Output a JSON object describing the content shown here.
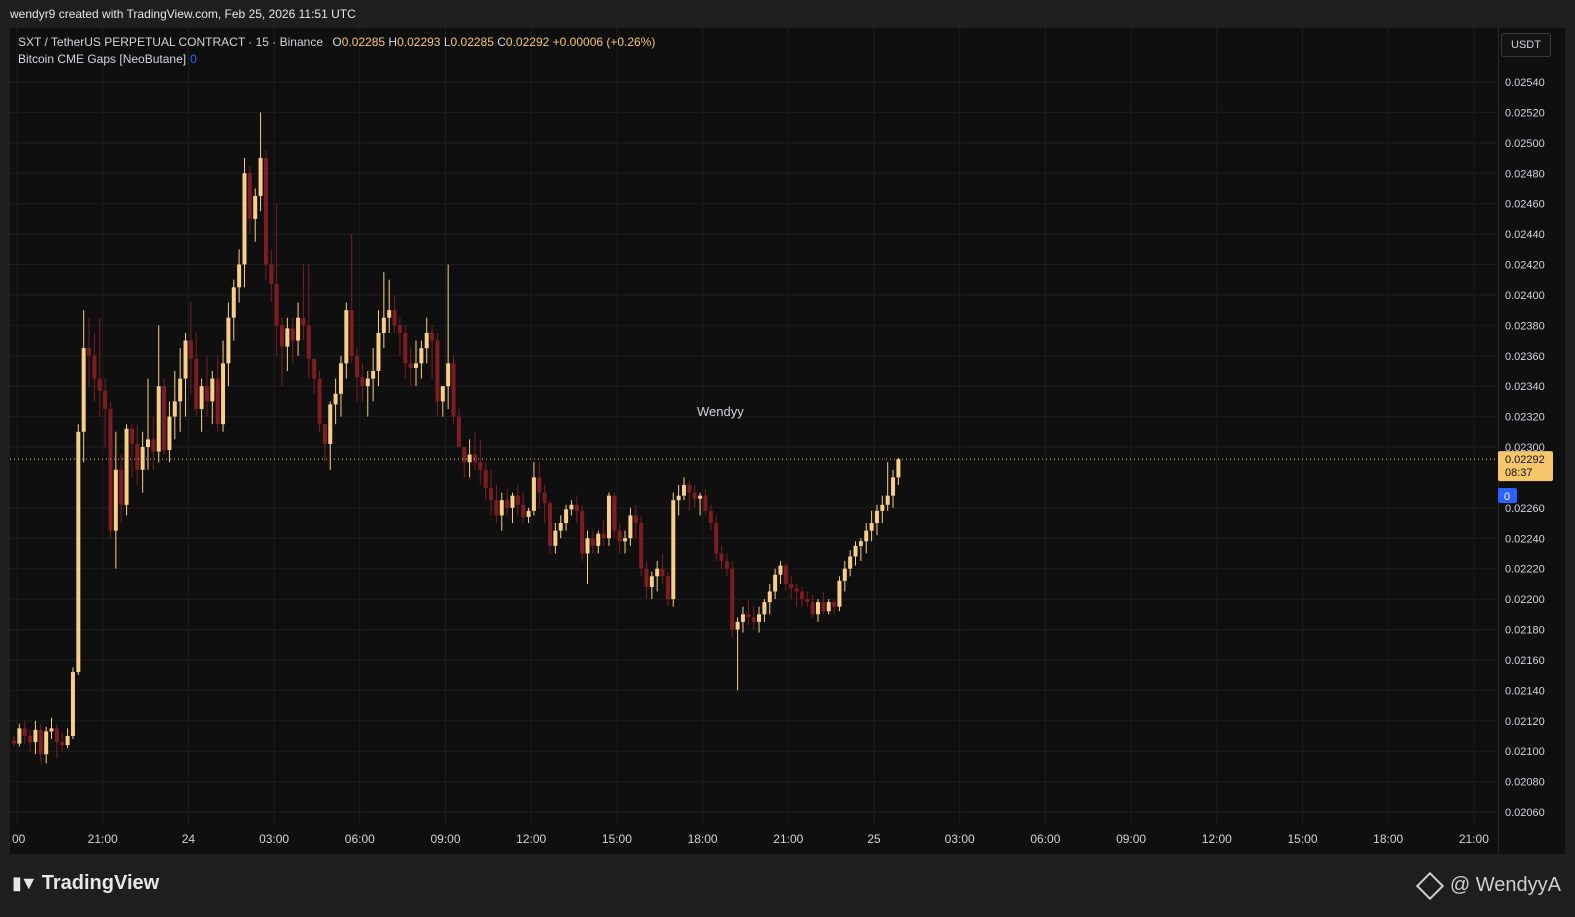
{
  "header": {
    "attribution": "wendyr9 created with TradingView.com, Feb 25, 2026 11:51 UTC"
  },
  "legend": {
    "symbol": "SXT / TetherUS PERPETUAL CONTRACT · 15 · Binance",
    "o_label": "O",
    "o_value": "0.02285",
    "h_label": "H",
    "h_value": "0.02293",
    "l_label": "L",
    "l_value": "0.02285",
    "c_label": "C",
    "c_value": "0.02292",
    "change": "+0.00006 (+0.26%)",
    "indicator": "Bitcoin CME Gaps [NeoButane]",
    "indicator_value": "0"
  },
  "currency_button": "USDT",
  "annotation_text": "Wendyy",
  "footer": {
    "brand": "TradingView",
    "watermark": "@ WendyyA"
  },
  "colors": {
    "bg": "#0f0f0f",
    "up": "#f7cf86",
    "down": "#7d1d22",
    "grid": "#1d1d1d",
    "last_price": "#f7c66b",
    "gap_badge": "#2962ff"
  },
  "chart_data": {
    "type": "candlestick",
    "title": "SXT / TetherUS PERPETUAL CONTRACT · 15 · Binance",
    "y_range": [
      0.0205,
      0.0256
    ],
    "y_ticks": [
      "0.02540",
      "0.02520",
      "0.02500",
      "0.02480",
      "0.02460",
      "0.02440",
      "0.02420",
      "0.02400",
      "0.02380",
      "0.02360",
      "0.02340",
      "0.02320",
      "0.02300",
      "0.02260",
      "0.02240",
      "0.02220",
      "0.02200",
      "0.02180",
      "0.02160",
      "0.02140",
      "0.02120",
      "0.02100",
      "0.02080",
      "0.02060"
    ],
    "x_ticks": [
      "00",
      "21:00",
      "24",
      "03:00",
      "06:00",
      "09:00",
      "12:00",
      "15:00",
      "18:00",
      "21:00",
      "25",
      "03:00",
      "06:00",
      "09:00",
      "12:00",
      "15:00",
      "18:00",
      "21:00"
    ],
    "last_price": "0.02292",
    "countdown": "08:37",
    "gap_value": "0",
    "candles": [
      [
        0.02107,
        0.0211,
        0.02103,
        0.02105
      ],
      [
        0.02105,
        0.02118,
        0.02103,
        0.02115
      ],
      [
        0.02115,
        0.0212,
        0.02105,
        0.0211
      ],
      [
        0.0211,
        0.02114,
        0.021,
        0.02106
      ],
      [
        0.02106,
        0.0212,
        0.02098,
        0.02114
      ],
      [
        0.02114,
        0.02118,
        0.02092,
        0.02098
      ],
      [
        0.02098,
        0.02116,
        0.02092,
        0.02113
      ],
      [
        0.02113,
        0.02122,
        0.02108,
        0.02115
      ],
      [
        0.02115,
        0.02118,
        0.02095,
        0.02106
      ],
      [
        0.02106,
        0.02112,
        0.021,
        0.02104
      ],
      [
        0.02104,
        0.02115,
        0.02102,
        0.0211
      ],
      [
        0.0211,
        0.02155,
        0.02108,
        0.02152
      ],
      [
        0.02152,
        0.02315,
        0.0215,
        0.0231
      ],
      [
        0.0231,
        0.0239,
        0.0229,
        0.02365
      ],
      [
        0.02365,
        0.02385,
        0.0234,
        0.0236
      ],
      [
        0.0236,
        0.02375,
        0.0233,
        0.02345
      ],
      [
        0.02345,
        0.02385,
        0.0232,
        0.02337
      ],
      [
        0.02337,
        0.02345,
        0.023,
        0.02325
      ],
      [
        0.02325,
        0.0233,
        0.0224,
        0.02245
      ],
      [
        0.02245,
        0.0231,
        0.0222,
        0.02285
      ],
      [
        0.02285,
        0.02295,
        0.0225,
        0.02262
      ],
      [
        0.02262,
        0.02315,
        0.02255,
        0.02312
      ],
      [
        0.02312,
        0.02315,
        0.0228,
        0.02302
      ],
      [
        0.02302,
        0.02315,
        0.02275,
        0.02285
      ],
      [
        0.02285,
        0.0231,
        0.0227,
        0.023
      ],
      [
        0.023,
        0.02345,
        0.02285,
        0.02305
      ],
      [
        0.02305,
        0.0232,
        0.02285,
        0.02297
      ],
      [
        0.02297,
        0.0238,
        0.0229,
        0.0234
      ],
      [
        0.0234,
        0.02345,
        0.02295,
        0.02298
      ],
      [
        0.02298,
        0.0233,
        0.0229,
        0.0232
      ],
      [
        0.0232,
        0.0235,
        0.02305,
        0.0233
      ],
      [
        0.0233,
        0.02365,
        0.0231,
        0.02345
      ],
      [
        0.02345,
        0.02375,
        0.0232,
        0.0237
      ],
      [
        0.0237,
        0.02395,
        0.02335,
        0.02358
      ],
      [
        0.02358,
        0.02375,
        0.0232,
        0.02325
      ],
      [
        0.02325,
        0.02345,
        0.0231,
        0.0234
      ],
      [
        0.0234,
        0.0236,
        0.0232,
        0.0233
      ],
      [
        0.0233,
        0.0235,
        0.02315,
        0.02345
      ],
      [
        0.02345,
        0.0236,
        0.0231,
        0.02315
      ],
      [
        0.02315,
        0.0237,
        0.0231,
        0.02355
      ],
      [
        0.02355,
        0.02395,
        0.0234,
        0.02385
      ],
      [
        0.02385,
        0.0241,
        0.0237,
        0.02405
      ],
      [
        0.02405,
        0.0243,
        0.02395,
        0.0242
      ],
      [
        0.0242,
        0.0249,
        0.02405,
        0.0248
      ],
      [
        0.0248,
        0.02485,
        0.0244,
        0.0245
      ],
      [
        0.0245,
        0.0247,
        0.02435,
        0.02465
      ],
      [
        0.02465,
        0.0252,
        0.02455,
        0.0249
      ],
      [
        0.0249,
        0.02495,
        0.0241,
        0.0242
      ],
      [
        0.0242,
        0.0243,
        0.02395,
        0.02407
      ],
      [
        0.02407,
        0.0246,
        0.0236,
        0.0238
      ],
      [
        0.0238,
        0.02385,
        0.0234,
        0.02366
      ],
      [
        0.02366,
        0.02385,
        0.0235,
        0.02378
      ],
      [
        0.02378,
        0.02385,
        0.02355,
        0.0237
      ],
      [
        0.0237,
        0.02395,
        0.0236,
        0.02385
      ],
      [
        0.02385,
        0.0242,
        0.0237,
        0.0238
      ],
      [
        0.0238,
        0.0242,
        0.02345,
        0.02358
      ],
      [
        0.02358,
        0.02355,
        0.02335,
        0.02345
      ],
      [
        0.02345,
        0.0235,
        0.0231,
        0.02315
      ],
      [
        0.02315,
        0.0231,
        0.0229,
        0.02302
      ],
      [
        0.02302,
        0.0233,
        0.02285,
        0.02328
      ],
      [
        0.02328,
        0.02345,
        0.02315,
        0.02335
      ],
      [
        0.02335,
        0.0236,
        0.0232,
        0.02355
      ],
      [
        0.02355,
        0.02395,
        0.02345,
        0.0239
      ],
      [
        0.0239,
        0.0244,
        0.02355,
        0.0236
      ],
      [
        0.0236,
        0.02365,
        0.0233,
        0.02346
      ],
      [
        0.02346,
        0.02355,
        0.0233,
        0.0234
      ],
      [
        0.0234,
        0.0235,
        0.0232,
        0.02345
      ],
      [
        0.02345,
        0.02365,
        0.0233,
        0.0235
      ],
      [
        0.0235,
        0.0239,
        0.0234,
        0.02375
      ],
      [
        0.02375,
        0.02415,
        0.02365,
        0.02385
      ],
      [
        0.02385,
        0.0241,
        0.02375,
        0.0239
      ],
      [
        0.0239,
        0.024,
        0.02375,
        0.0238
      ],
      [
        0.0238,
        0.02385,
        0.0236,
        0.02375
      ],
      [
        0.02375,
        0.0238,
        0.02345,
        0.02355
      ],
      [
        0.02355,
        0.02365,
        0.0234,
        0.02352
      ],
      [
        0.02352,
        0.0237,
        0.0234,
        0.02355
      ],
      [
        0.02355,
        0.0237,
        0.02345,
        0.02365
      ],
      [
        0.02365,
        0.02385,
        0.02355,
        0.02375
      ],
      [
        0.02375,
        0.0238,
        0.02345,
        0.0237
      ],
      [
        0.0237,
        0.02375,
        0.0232,
        0.0233
      ],
      [
        0.0233,
        0.0234,
        0.0232,
        0.0234
      ],
      [
        0.0234,
        0.0242,
        0.02325,
        0.02355
      ],
      [
        0.02355,
        0.0236,
        0.02315,
        0.0232
      ],
      [
        0.0232,
        0.02325,
        0.023,
        0.023
      ],
      [
        0.023,
        0.023,
        0.0228,
        0.0229
      ],
      [
        0.0229,
        0.02305,
        0.0228,
        0.02295
      ],
      [
        0.02295,
        0.0231,
        0.02285,
        0.0229
      ],
      [
        0.0229,
        0.02305,
        0.02275,
        0.02285
      ],
      [
        0.02285,
        0.0229,
        0.02265,
        0.02273
      ],
      [
        0.02273,
        0.02285,
        0.02255,
        0.02265
      ],
      [
        0.02265,
        0.02275,
        0.0225,
        0.02255
      ],
      [
        0.02255,
        0.0227,
        0.02245,
        0.02265
      ],
      [
        0.02265,
        0.02272,
        0.02255,
        0.0226
      ],
      [
        0.0226,
        0.0227,
        0.0225,
        0.02268
      ],
      [
        0.02268,
        0.02275,
        0.02255,
        0.02262
      ],
      [
        0.02262,
        0.0227,
        0.0225,
        0.02254
      ],
      [
        0.02254,
        0.0226,
        0.0225,
        0.02258
      ],
      [
        0.02258,
        0.0229,
        0.02255,
        0.0228
      ],
      [
        0.0228,
        0.0229,
        0.0226,
        0.0227
      ],
      [
        0.0227,
        0.02275,
        0.0225,
        0.02263
      ],
      [
        0.02263,
        0.02265,
        0.0223,
        0.02235
      ],
      [
        0.02235,
        0.0225,
        0.0223,
        0.02245
      ],
      [
        0.02245,
        0.02255,
        0.0224,
        0.0225
      ],
      [
        0.0225,
        0.02262,
        0.02245,
        0.02259
      ],
      [
        0.02259,
        0.02265,
        0.02255,
        0.02262
      ],
      [
        0.02262,
        0.02268,
        0.0225,
        0.02258
      ],
      [
        0.02258,
        0.02262,
        0.02225,
        0.0223
      ],
      [
        0.0223,
        0.02245,
        0.0221,
        0.0224
      ],
      [
        0.0224,
        0.02245,
        0.0223,
        0.02235
      ],
      [
        0.02235,
        0.02245,
        0.0223,
        0.02243
      ],
      [
        0.02243,
        0.02252,
        0.02235,
        0.0224
      ],
      [
        0.0224,
        0.0227,
        0.02235,
        0.02268
      ],
      [
        0.02268,
        0.0227,
        0.0224,
        0.02245
      ],
      [
        0.02245,
        0.0225,
        0.0223,
        0.02238
      ],
      [
        0.02238,
        0.02245,
        0.0223,
        0.0224
      ],
      [
        0.0224,
        0.0226,
        0.02235,
        0.02255
      ],
      [
        0.02255,
        0.02262,
        0.0224,
        0.0225
      ],
      [
        0.0225,
        0.02255,
        0.02215,
        0.0222
      ],
      [
        0.0222,
        0.02225,
        0.022,
        0.02208
      ],
      [
        0.02208,
        0.02218,
        0.022,
        0.02215
      ],
      [
        0.02215,
        0.02225,
        0.02205,
        0.0222
      ],
      [
        0.0222,
        0.0223,
        0.0221,
        0.02215
      ],
      [
        0.02215,
        0.02218,
        0.02195,
        0.022
      ],
      [
        0.022,
        0.0227,
        0.02195,
        0.02265
      ],
      [
        0.02265,
        0.02275,
        0.02255,
        0.02268
      ],
      [
        0.02268,
        0.0228,
        0.02265,
        0.02275
      ],
      [
        0.02275,
        0.02278,
        0.02258,
        0.0227
      ],
      [
        0.0227,
        0.02275,
        0.0226,
        0.02266
      ],
      [
        0.02266,
        0.0227,
        0.02255,
        0.02268
      ],
      [
        0.02268,
        0.02272,
        0.02255,
        0.02258
      ],
      [
        0.02258,
        0.02262,
        0.02245,
        0.0225
      ],
      [
        0.0225,
        0.02255,
        0.02225,
        0.0223
      ],
      [
        0.0223,
        0.02235,
        0.0222,
        0.02225
      ],
      [
        0.02225,
        0.0223,
        0.02215,
        0.0222
      ],
      [
        0.0222,
        0.02225,
        0.02175,
        0.0218
      ],
      [
        0.0218,
        0.02188,
        0.0214,
        0.02185
      ],
      [
        0.02185,
        0.02195,
        0.02178,
        0.0219
      ],
      [
        0.0219,
        0.022,
        0.02183,
        0.02188
      ],
      [
        0.02188,
        0.02195,
        0.0218,
        0.02185
      ],
      [
        0.02185,
        0.02195,
        0.02178,
        0.0219
      ],
      [
        0.0219,
        0.022,
        0.02185,
        0.02198
      ],
      [
        0.02198,
        0.0221,
        0.0219,
        0.02205
      ],
      [
        0.02205,
        0.0222,
        0.022,
        0.02216
      ],
      [
        0.02216,
        0.02225,
        0.0221,
        0.02222
      ],
      [
        0.02222,
        0.02224,
        0.02205,
        0.0221
      ],
      [
        0.0221,
        0.02215,
        0.022,
        0.02207
      ],
      [
        0.02207,
        0.0221,
        0.02195,
        0.02205
      ],
      [
        0.02205,
        0.02208,
        0.02195,
        0.022
      ],
      [
        0.022,
        0.02205,
        0.02195,
        0.02198
      ],
      [
        0.02198,
        0.02203,
        0.02188,
        0.0219
      ],
      [
        0.0219,
        0.022,
        0.02185,
        0.02198
      ],
      [
        0.02198,
        0.02205,
        0.0219,
        0.02192
      ],
      [
        0.02192,
        0.022,
        0.0219,
        0.02198
      ],
      [
        0.02198,
        0.022,
        0.0219,
        0.02195
      ],
      [
        0.02195,
        0.02215,
        0.02192,
        0.02212
      ],
      [
        0.02212,
        0.02225,
        0.02205,
        0.0222
      ],
      [
        0.0222,
        0.02232,
        0.02215,
        0.02228
      ],
      [
        0.02228,
        0.02238,
        0.02222,
        0.02235
      ],
      [
        0.02235,
        0.0224,
        0.02225,
        0.02238
      ],
      [
        0.02238,
        0.0225,
        0.0223,
        0.02245
      ],
      [
        0.02245,
        0.02258,
        0.02238,
        0.0225
      ],
      [
        0.0225,
        0.02262,
        0.02242,
        0.02258
      ],
      [
        0.02258,
        0.02268,
        0.0225,
        0.02262
      ],
      [
        0.02262,
        0.0229,
        0.02258,
        0.02268
      ],
      [
        0.02268,
        0.02285,
        0.0226,
        0.0228
      ],
      [
        0.0228,
        0.02293,
        0.02275,
        0.02292
      ]
    ]
  }
}
